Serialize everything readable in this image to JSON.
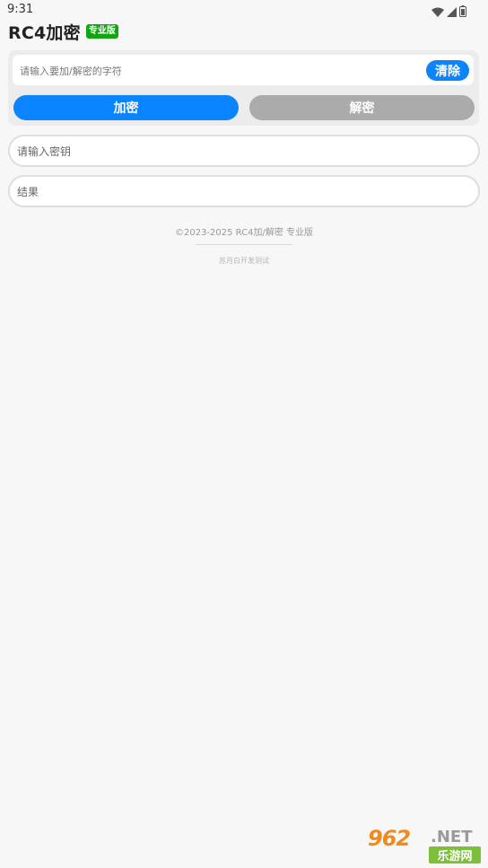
{
  "status_bar": {
    "time": "9:31",
    "icons": [
      "wifi-icon",
      "signal-icon",
      "battery-icon"
    ]
  },
  "header": {
    "title": "RC4加密",
    "badge": "专业版"
  },
  "input_card": {
    "text_input": {
      "placeholder": "请输入要加/解密的字符",
      "value": ""
    },
    "clear_label": "清除",
    "encrypt_label": "加密",
    "decrypt_label": "解密"
  },
  "key_field": {
    "placeholder": "请输入密钥",
    "value": ""
  },
  "result_field": {
    "placeholder": "结果",
    "value": ""
  },
  "footer": {
    "copyright": "©2023-2025 RC4加/解密 专业版",
    "developer": "苏月白开发测试"
  },
  "watermark": {
    "number": "962",
    "domain": ".NET",
    "brand": "乐游网"
  },
  "colors": {
    "primary": "#0a84ff",
    "disabled": "#ababab",
    "badge": "#11a611",
    "background": "#f7f7f7"
  }
}
